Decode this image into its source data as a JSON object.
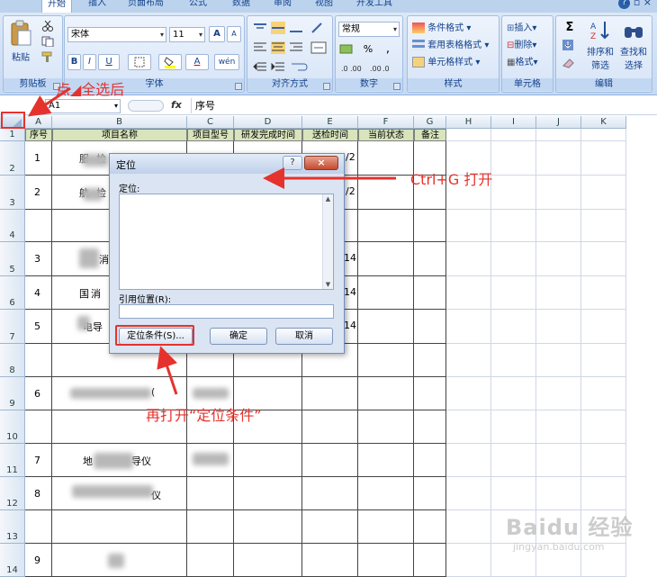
{
  "ribbon": {
    "tabs": [
      "开始",
      "插入",
      "页面布局",
      "公式",
      "数据",
      "审阅",
      "视图",
      "开发工具"
    ],
    "window_controls": "– ▫ ×",
    "clipboard": {
      "paste": "粘贴",
      "label": "剪贴板"
    },
    "font": {
      "name": "宋体",
      "size": "11",
      "bold": "B",
      "italic": "I",
      "underline": "U",
      "grow": "A",
      "shrink": "A",
      "font_color": "A",
      "phonetic": "wén",
      "label": "字体"
    },
    "alignment": {
      "label": "对齐方式"
    },
    "number": {
      "format": "常规",
      "percent": "%",
      "comma": ",",
      "label": "数字"
    },
    "styles": {
      "conditional": "条件格式",
      "table": "套用表格格式",
      "cell": "单元格样式",
      "label": "样式"
    },
    "cells": {
      "insert": "插入",
      "delete": "删除",
      "format": "格式",
      "label": "单元格"
    },
    "editing": {
      "sum": "Σ",
      "sort_filter_1": "排序和",
      "sort_filter_2": "筛选",
      "find_select_1": "查找和",
      "find_select_2": "选择",
      "label": "编辑"
    }
  },
  "formula_bar": {
    "name_box": "A1",
    "fx": "fx",
    "content": "序号"
  },
  "columns": [
    "A",
    "B",
    "C",
    "D",
    "E",
    "F",
    "G",
    "H",
    "I",
    "J",
    "K"
  ],
  "rows": [
    "1",
    "2",
    "3",
    "4",
    "5",
    "6",
    "7",
    "8",
    "9",
    "10",
    "11",
    "12",
    "13",
    "14"
  ],
  "header_cells": [
    "序号",
    "项目名称",
    "项目型号",
    "研发完成时间",
    "送检时间",
    "当前状态",
    "备注"
  ],
  "serials": [
    "1",
    "2",
    "3",
    "4",
    "5",
    "6",
    "7",
    "8",
    "9"
  ],
  "visible_fragments": {
    "r1b": "服",
    "r1b2": "检",
    "r1e": "/2",
    "r2b": "航",
    "r2b2": "检",
    "r2e": "/2",
    "r3b": "消",
    "r3e": "14",
    "r4b": "国",
    "r4b2": "消",
    "r4e": "14",
    "r5b": "电导",
    "r5e": "14",
    "r6b": "(",
    "r7b": "地",
    "r7b2": "导仪",
    "r8b": "仪"
  },
  "dialog": {
    "title": "定位",
    "help": "?",
    "close": "×",
    "goto_label": "定位:",
    "reference_label": "引用位置(R):",
    "special_button": "定位条件(S)...",
    "ok_button": "确定",
    "cancel_button": "取消"
  },
  "annotations": {
    "select_all": "点◢全选后",
    "ctrl_g": "Ctrl+G 打开",
    "special": "再打开“定位条件”"
  },
  "watermark": {
    "logo": "Baidu 经验",
    "url": "jingyan.baidu.com"
  }
}
